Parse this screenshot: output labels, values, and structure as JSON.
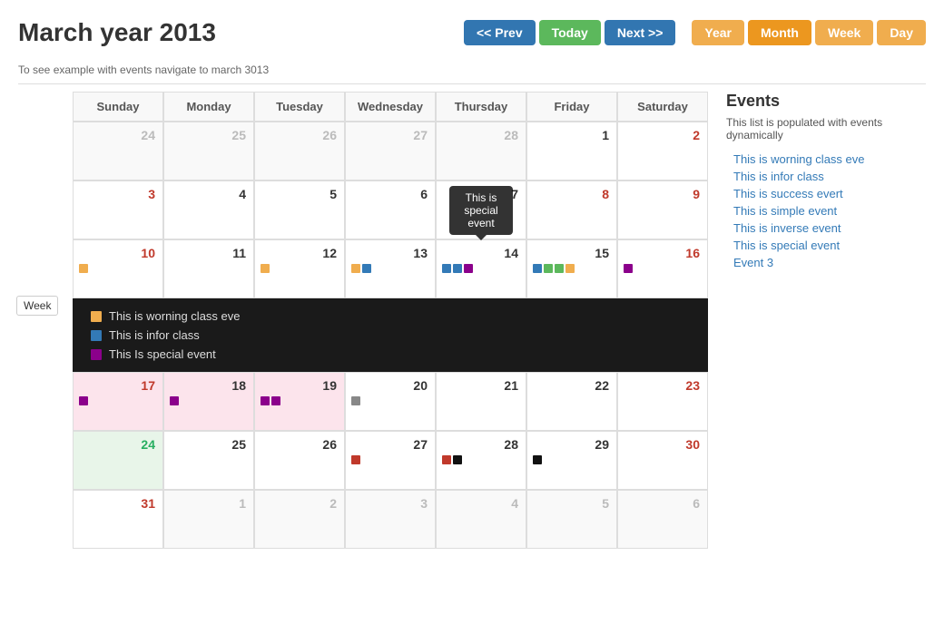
{
  "header": {
    "title": "March year 2013",
    "subtitle": "To see example with events navigate to march 3013",
    "buttons": {
      "prev": "<< Prev",
      "today": "Today",
      "next": "Next >>",
      "year": "Year",
      "month": "Month",
      "week": "Week",
      "day": "Day"
    }
  },
  "calendar": {
    "dayHeaders": [
      "Sunday",
      "Monday",
      "Tuesday",
      "Wednesday",
      "Thursday",
      "Friday",
      "Saturday"
    ],
    "weekLabel": "Week"
  },
  "tooltip": {
    "text": "This is\nspecial\nevent"
  },
  "expandedRow": {
    "items": [
      {
        "color": "yellow",
        "label": "This is worning class eve"
      },
      {
        "color": "blue",
        "label": "This is infor class"
      },
      {
        "color": "purple",
        "label": "This is special event"
      }
    ]
  },
  "events": {
    "title": "Events",
    "description": "This list is populated with events dynamically",
    "links": [
      "This is worning class eve",
      "This is infor class",
      "This is success evert",
      "This is simple event",
      "This is inverse event",
      "This is special event",
      "Event 3"
    ]
  }
}
